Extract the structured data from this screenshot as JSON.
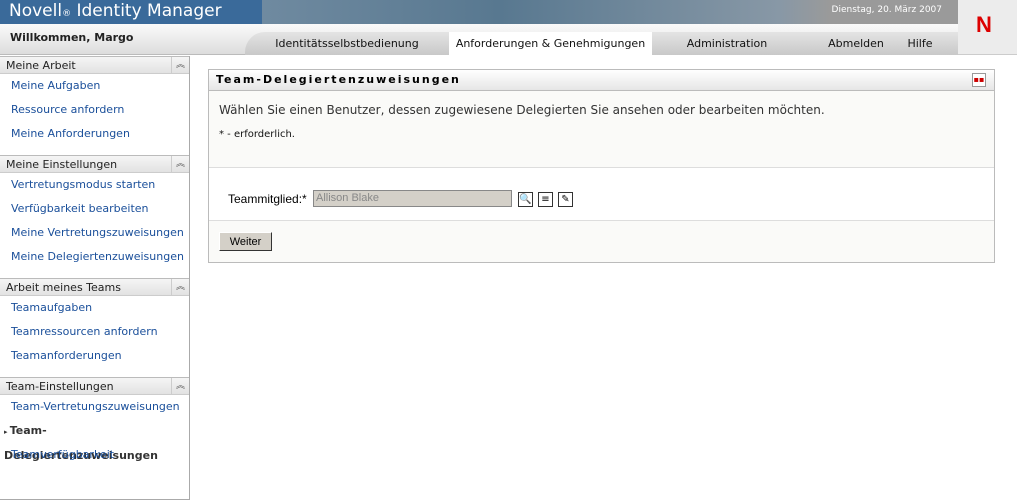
{
  "header": {
    "app_name": "Novell",
    "reg": "®",
    "product": " Identity Manager",
    "date": "Dienstag, 20. März 2007",
    "logo": "N",
    "welcome": "Willkommen, Margo"
  },
  "tabs": [
    {
      "label": "Identitätsselbstbedienung"
    },
    {
      "label": "Anforderungen & Genehmigungen",
      "active": true
    },
    {
      "label": "Administration"
    },
    {
      "label": "Abmelden"
    },
    {
      "label": "Hilfe"
    }
  ],
  "sidebar": {
    "sections": [
      {
        "title": "Meine Arbeit",
        "items": [
          "Meine Aufgaben",
          "Ressource anfordern",
          "Meine Anforderungen"
        ]
      },
      {
        "title": "Meine Einstellungen",
        "items": [
          "Vertretungsmodus starten",
          "Verfügbarkeit bearbeiten",
          "Meine Vertretungszuweisungen",
          "Meine Delegiertenzuweisungen"
        ]
      },
      {
        "title": "Arbeit meines Teams",
        "items": [
          "Teamaufgaben",
          "Teamressourcen anfordern",
          "Teamanforderungen"
        ]
      },
      {
        "title": "Team-Einstellungen",
        "items": [
          "Team-Vertretungszuweisungen",
          "Team-Delegiertenzuweisungen",
          "Teamverfügbarkeit"
        ]
      }
    ],
    "current": "Team-Delegiertenzuweisungen"
  },
  "panel": {
    "title": "Team-Delegiertenzuweisungen",
    "description": "Wählen Sie einen Benutzer, dessen zugewiesene Delegierten Sie ansehen oder bearbeiten möchten.",
    "required_note": "* - erforderlich.",
    "field_label": "Teammitglied:*",
    "field_value": "Allison Blake",
    "button": "Weiter"
  }
}
